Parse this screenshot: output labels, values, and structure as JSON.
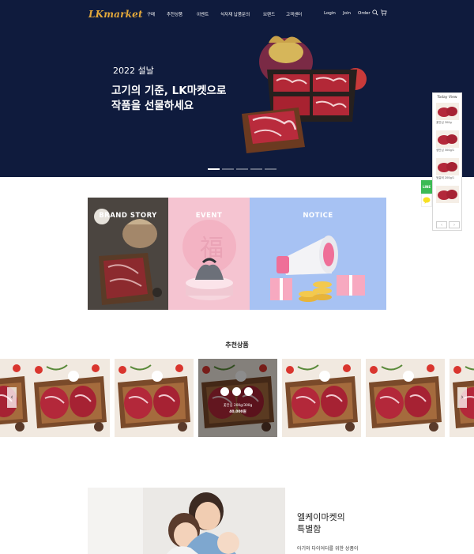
{
  "header": {
    "logo": "LKmarket",
    "nav": [
      "구매",
      "추천상품",
      "이벤트",
      "식자재 납품문의",
      "브랜드",
      "고객센터"
    ],
    "util": [
      "Login",
      "Join",
      "Order"
    ]
  },
  "hero": {
    "year": "2022 설날",
    "title_line1": "고기의 기준, LK마켓으로",
    "title_line2": "작품을 선물하세요",
    "slides": 5,
    "active_slide": 1
  },
  "today_view": {
    "title": "Today View",
    "items": [
      "꽃안심 300g",
      "생안심 300g/1",
      "뒷갈비 200g/1"
    ],
    "prev": "‹",
    "next": "›"
  },
  "quick": {
    "top": "LINE"
  },
  "banners": [
    {
      "label": "BRAND STORY"
    },
    {
      "label": "EVENT"
    },
    {
      "label": "NOTICE"
    }
  ],
  "recommended": {
    "title": "추천상품",
    "hover_name": "꽃안심 200g/300g",
    "hover_price": "40,000원",
    "prev": "‹",
    "next": "›"
  },
  "special": {
    "title_line1": "엘케이마켓의",
    "title_line2": "특별함",
    "subtitle": "아기와 다이어터를 위한 상품이"
  },
  "colors": {
    "hero_bg": "#0f1b3d",
    "logo": "#e4a93b",
    "event_bg": "#f5c4d1",
    "notice_bg": "#a7c2f3"
  }
}
